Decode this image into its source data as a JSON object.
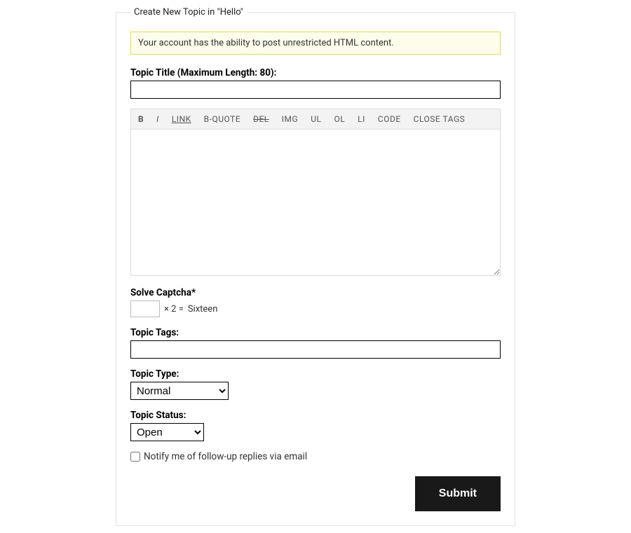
{
  "legend": "Create New Topic in \"Hello\"",
  "notice": "Your account has the ability to post unrestricted HTML content.",
  "title_label": "Topic Title (Maximum Length: 80):",
  "toolbar": {
    "b": "B",
    "i": "I",
    "link": "LINK",
    "bquote": "B-QUOTE",
    "del": "DEL",
    "img": "IMG",
    "ul": "UL",
    "ol": "OL",
    "li": "LI",
    "code": "CODE",
    "close": "CLOSE TAGS"
  },
  "captcha": {
    "label": "Solve Captcha*",
    "expr_prefix": "× 2  =  ",
    "expr_answer": "Sixteen"
  },
  "tags_label": "Topic Tags:",
  "type": {
    "label": "Topic Type:",
    "selected": "Normal"
  },
  "status": {
    "label": "Topic Status:",
    "selected": "Open"
  },
  "notify_label": "Notify me of follow-up replies via email",
  "submit": "Submit"
}
